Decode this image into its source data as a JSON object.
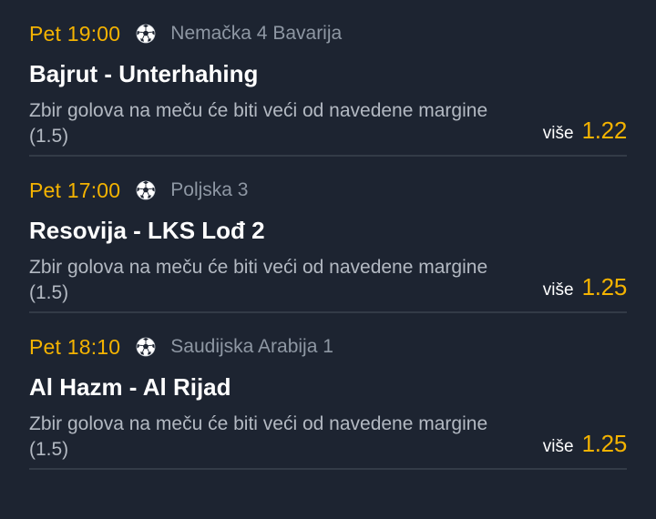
{
  "matches": [
    {
      "time": "Pet 19:00",
      "sport_icon": "soccer-ball-icon",
      "league": "Nemačka 4 Bavarija",
      "teams": "Bajrut - Unterhahing",
      "market": "Zbir golova na meču će biti veći od navedene margine (1.5)",
      "pick_label": "više",
      "odds": "1.22"
    },
    {
      "time": "Pet 17:00",
      "sport_icon": "soccer-ball-icon",
      "league": "Poljska 3",
      "teams": "Resovija - LKS Lođ 2",
      "market": "Zbir golova na meču će biti veći od navedene margine (1.5)",
      "pick_label": "više",
      "odds": "1.25"
    },
    {
      "time": "Pet 18:10",
      "sport_icon": "soccer-ball-icon",
      "league": "Saudijska Arabija 1",
      "teams": "Al Hazm - Al Rijad",
      "market": "Zbir golova na meču će biti veći od navedene margine (1.5)",
      "pick_label": "više",
      "odds": "1.25"
    }
  ],
  "colors": {
    "background": "#1d2431",
    "accent": "#f4b301",
    "divider": "#333b47",
    "secondary_text": "#8e97a3"
  }
}
